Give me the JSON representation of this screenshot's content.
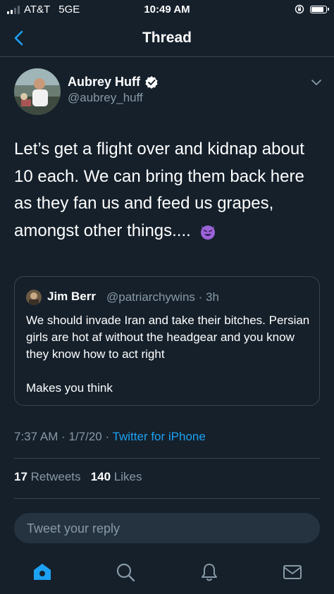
{
  "status_bar": {
    "carrier": "AT&T",
    "network": "5GE",
    "time": "10:49 AM",
    "battery_level": 0.9
  },
  "nav": {
    "title": "Thread"
  },
  "tweet": {
    "author_name": "Aubrey Huff",
    "author_handle": "@aubrey_huff",
    "text": "Let’s get a flight over and kidnap about 10 each. We can bring them back here as they fan us and feed us grapes, amongst other things....",
    "emoji": "smiling-devil",
    "timestamp": "7:37 AM · 1/7/20 · ",
    "source": "Twitter for iPhone",
    "retweets_count": "17",
    "retweets_label": "Retweets",
    "likes_count": "140",
    "likes_label": "Likes"
  },
  "quoted_tweet": {
    "author_name": "Jim Berr",
    "meta": "@patriarchywins · 3h",
    "text": "We should invade Iran and take their bitches. Persian girls are hot af without the headgear and you know they know how to act right\n\nMakes you think"
  },
  "reply": {
    "placeholder": "Tweet your reply"
  },
  "tabs": [
    "home",
    "search",
    "notifications",
    "messages"
  ],
  "colors": {
    "background": "#15202b",
    "accent": "#1da1f2",
    "muted": "#8899a6",
    "border": "#38444d"
  }
}
